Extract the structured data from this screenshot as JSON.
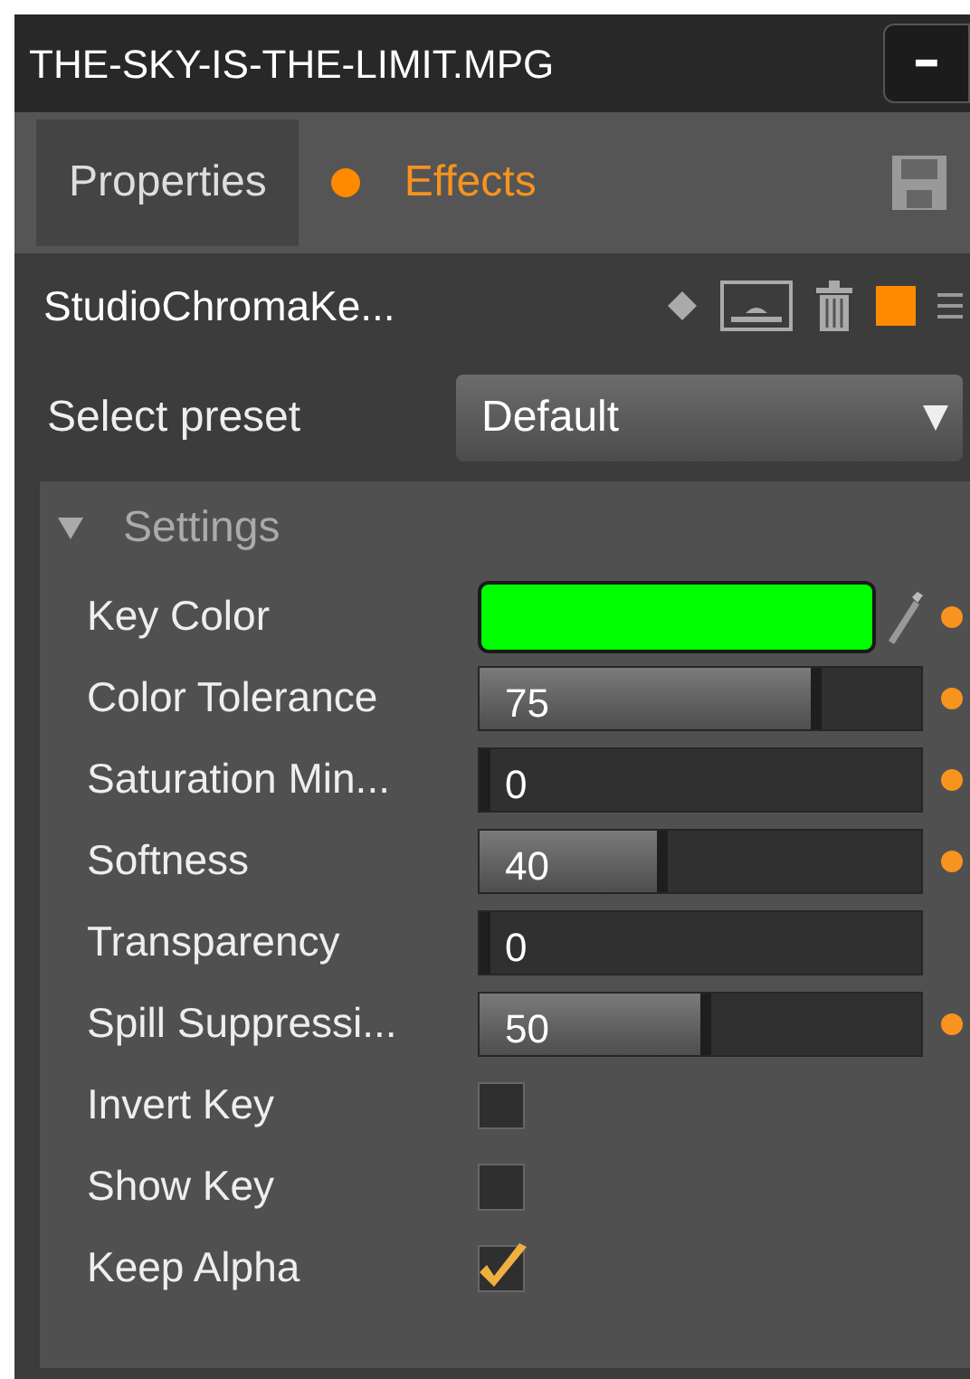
{
  "window": {
    "title": "THE-SKY-IS-THE-LIMIT.MPG",
    "minimize_label": "━"
  },
  "tabs": [
    {
      "label": "Properties",
      "selected": false,
      "dot": false
    },
    {
      "label": "Effects",
      "selected": true,
      "dot": true
    }
  ],
  "effect": {
    "name": "StudioChromaKe...",
    "enabled": true
  },
  "preset": {
    "label": "Select preset",
    "value": "Default"
  },
  "group": {
    "title": "Settings",
    "expanded": true
  },
  "rows": [
    {
      "kind": "color",
      "label": "Key Color",
      "color": "#00ff00",
      "keyframed": true
    },
    {
      "kind": "slider",
      "label": "Color Tolerance",
      "value": "75",
      "level": 0.75,
      "keyframed": true
    },
    {
      "kind": "slider",
      "label": "Saturation Min...",
      "value": "0",
      "level": 0,
      "keyframed": true
    },
    {
      "kind": "slider",
      "label": "Softness",
      "value": "40",
      "level": 0.4,
      "keyframed": true
    },
    {
      "kind": "slider",
      "label": "Transparency",
      "value": "0",
      "level": 0,
      "keyframed": false
    },
    {
      "kind": "slider",
      "label": "Spill Suppressi...",
      "value": "50",
      "level": 0.5,
      "keyframed": true
    },
    {
      "kind": "checkbox",
      "label": "Invert Key",
      "checked": false
    },
    {
      "kind": "checkbox",
      "label": "Show Key",
      "checked": false
    },
    {
      "kind": "checkbox",
      "label": "Keep Alpha",
      "checked": true
    }
  ]
}
